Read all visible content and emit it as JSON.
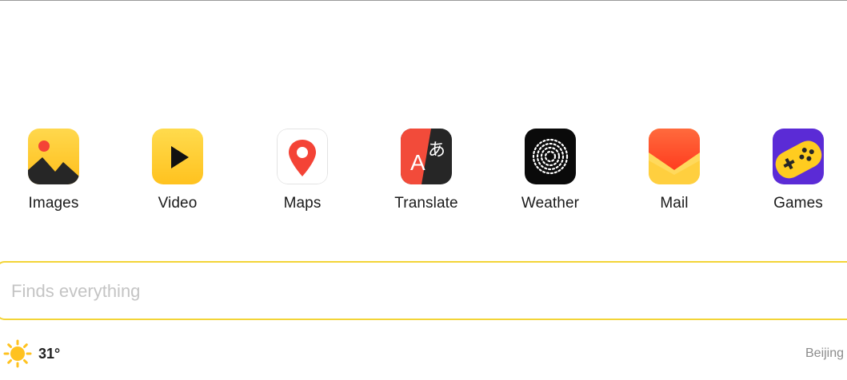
{
  "services": [
    {
      "id": "images",
      "label": "Images",
      "icon": "images-icon"
    },
    {
      "id": "video",
      "label": "Video",
      "icon": "video-play-icon"
    },
    {
      "id": "maps",
      "label": "Maps",
      "icon": "map-pin-icon"
    },
    {
      "id": "translate",
      "label": "Translate",
      "icon": "translate-icon"
    },
    {
      "id": "weather",
      "label": "Weather",
      "icon": "weather-swirl-icon"
    },
    {
      "id": "mail",
      "label": "Mail",
      "icon": "mail-envelope-icon"
    },
    {
      "id": "games",
      "label": "Games",
      "icon": "gamepad-icon"
    }
  ],
  "search": {
    "placeholder": "Finds everything",
    "value": ""
  },
  "weather": {
    "temperature": "31°",
    "icon": "sun-icon"
  },
  "location": {
    "city": "Beijing"
  },
  "colors": {
    "accent_yellow": "#f3d437",
    "maps_red": "#f44336",
    "translate_red": "#f24b3a",
    "games_purple": "#5b2bd6"
  }
}
